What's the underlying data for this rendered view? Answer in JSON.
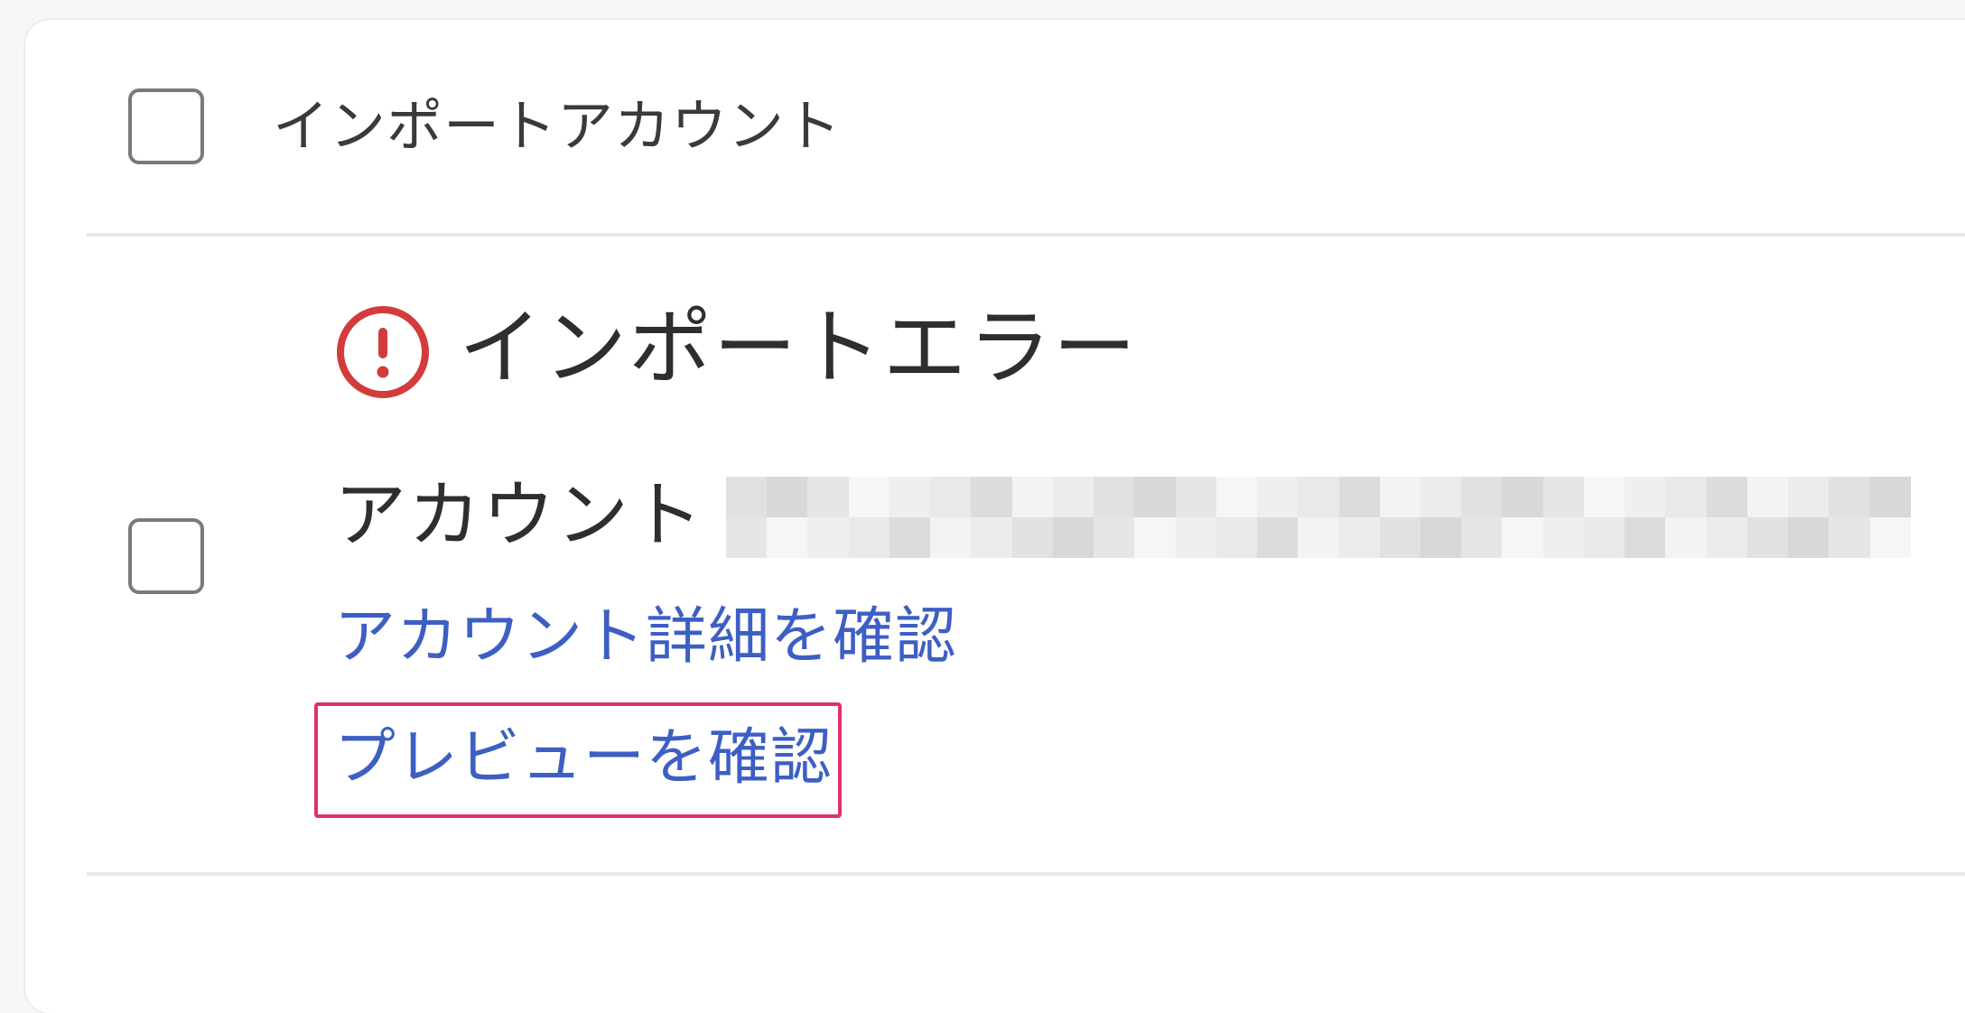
{
  "header": {
    "select_all_label": "インポートアカウント"
  },
  "item": {
    "status_title": "インポートエラー",
    "account_label": "アカウント",
    "account_value_redacted": true,
    "links": {
      "view_account_details": "アカウント詳細を確認",
      "view_preview": "プレビューを確認"
    }
  },
  "colors": {
    "error": "#d23c3c",
    "link": "#3d5fc4",
    "highlight": "#e0306a",
    "divider": "#e8e8e8",
    "checkbox_border": "#7a7a7a"
  },
  "icons": {
    "status": "error-circle-icon"
  }
}
